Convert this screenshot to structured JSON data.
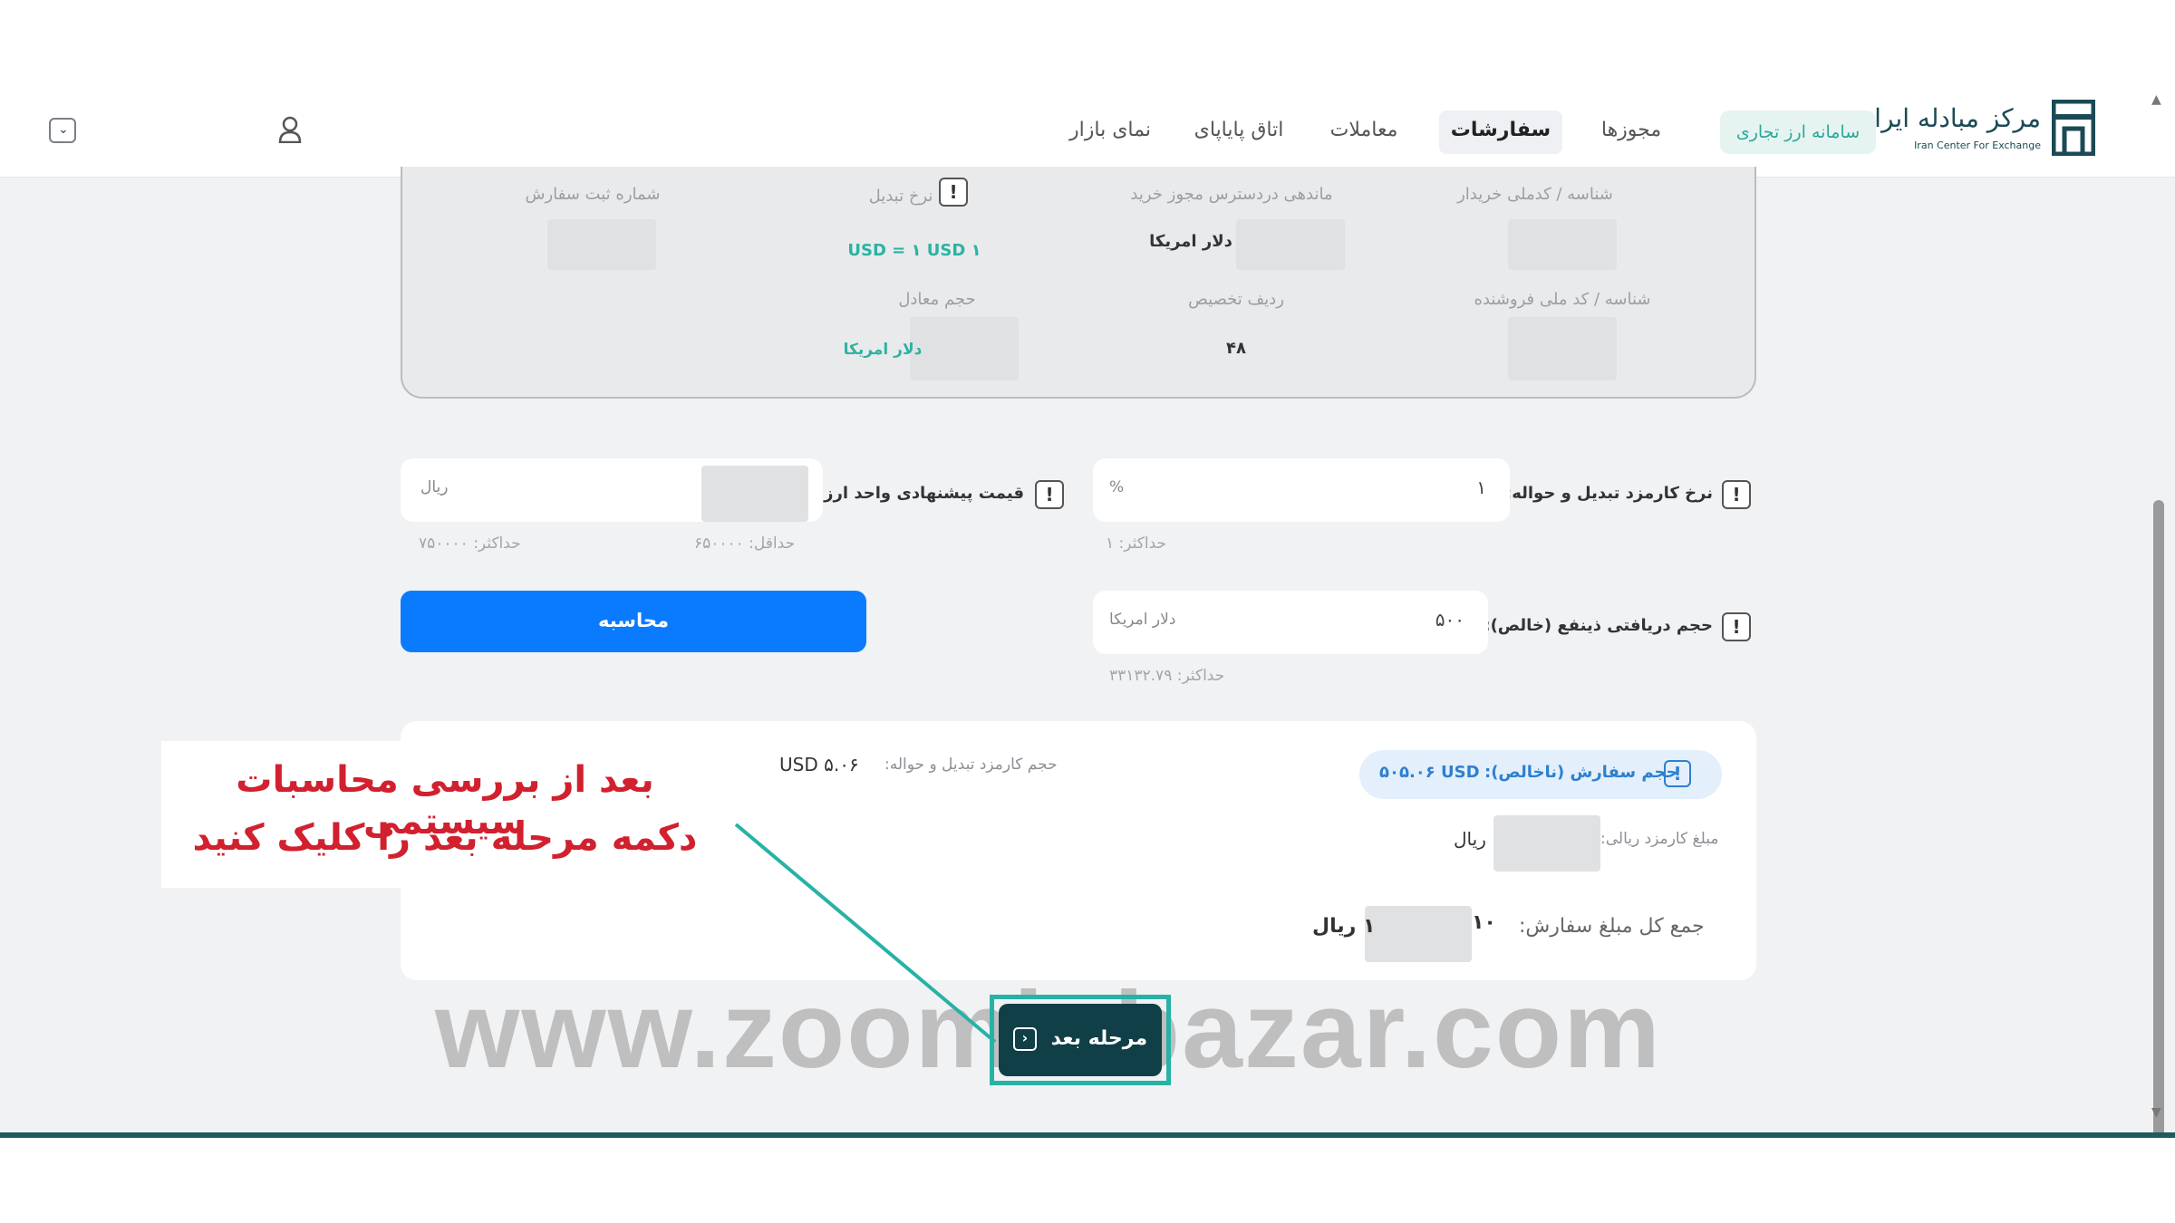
{
  "header": {
    "logo_text": "مرکز مبادله ایران",
    "logo_sub": "Iran Center For Exchange",
    "forex_system": "سامانه ارز تجاری",
    "nav": {
      "permits": "مجوزها",
      "orders": "سفارشات",
      "transactions": "معاملات",
      "papaya_room": "اتاق پایاپای",
      "market_view": "نمای بازار"
    }
  },
  "info": {
    "buyer_id_label": "شناسه / کدملی خریدار",
    "permit_balance_label": "ماندهی دردسترس مجوز خرید",
    "permit_balance_value": "دلار امریکا",
    "conversion_rate_label": "نرخ تبدیل",
    "conversion_rate_value": "۱ USD = ۱ USD",
    "order_reg_label": "شماره ثبت سفارش",
    "seller_id_label": "شناسه / کد ملی فروشنده",
    "allocation_row_label": "ردیف تخصیص",
    "allocation_row_value": "۴۸",
    "equivalent_volume_label": "حجم معادل",
    "equivalent_volume_value": "دلار امریکا"
  },
  "form": {
    "fee_rate_label": "نرخ کارمزد تبدیل و حواله:",
    "fee_rate_value": "۱",
    "fee_rate_unit": "%",
    "fee_rate_max": "حداکثر: ۱",
    "proposed_price_label": "قیمت پیشنهادی واحد ارز:",
    "proposed_price_unit": "ریال",
    "proposed_price_min": "حداقل: ۶۵۰۰۰۰",
    "proposed_price_max": "حداکثر: ۷۵۰۰۰۰",
    "net_volume_label": "حجم دریافتی ذینفع (خالص):",
    "net_volume_value": "۵۰۰",
    "net_volume_unit": "دلار امریکا",
    "net_volume_max": "حداکثر: ۳۳۱۳۲.۷۹",
    "calculate_label": "محاسبه"
  },
  "summary": {
    "order_volume_label": "حجم سفارش (ناخالص):",
    "order_volume_value": "۵۰۵.۰۶ USD",
    "fee_volume_label": "حجم کارمزد تبدیل و حواله:",
    "fee_volume_value": "USD ۵.۰۶",
    "rial_fee_label": "مبلغ کارمزد ریالی:",
    "rial_fee_unit": "ریال",
    "total_label": "جمع کل مبلغ سفارش:",
    "total_prefix": "۱۰",
    "total_suffix": "۱ ریال"
  },
  "next_button_label": "مرحله بعد",
  "annotation": {
    "line1": "بعد از بررسی محاسبات سیستمی",
    "line2": "دکمه مرحله بعد را کلیک کنید"
  },
  "watermark": "www.zoominbazar.com",
  "colors": {
    "primary_blue": "#0a7bff",
    "teal": "#2bb3a1",
    "dark_teal": "#103f47",
    "annotation_red": "#d1202e"
  }
}
